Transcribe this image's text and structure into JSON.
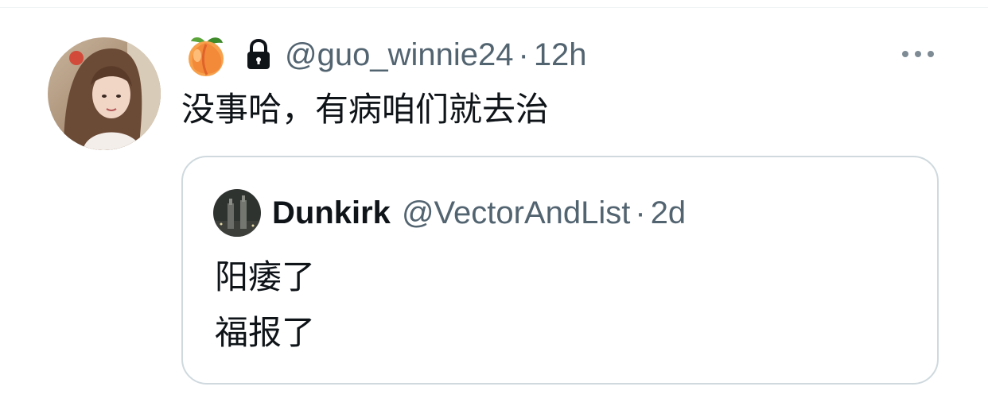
{
  "tweet": {
    "display_name_icons": [
      "peach-icon",
      "lock-icon"
    ],
    "handle": "@guo_winnie24",
    "separator": "·",
    "time": "12h",
    "text": "没事哈，有病咱们就去治",
    "more_icon": "more-horizontal-icon"
  },
  "quoted_tweet": {
    "display_name": "Dunkirk",
    "handle": "@VectorAndList",
    "separator": "·",
    "time": "2d",
    "lines": [
      "阳痿了",
      "福报了"
    ]
  },
  "colors": {
    "secondary_text": "#536471",
    "primary_text": "#0f1419",
    "border": "#cfd9de",
    "divider": "#eff3f4"
  }
}
